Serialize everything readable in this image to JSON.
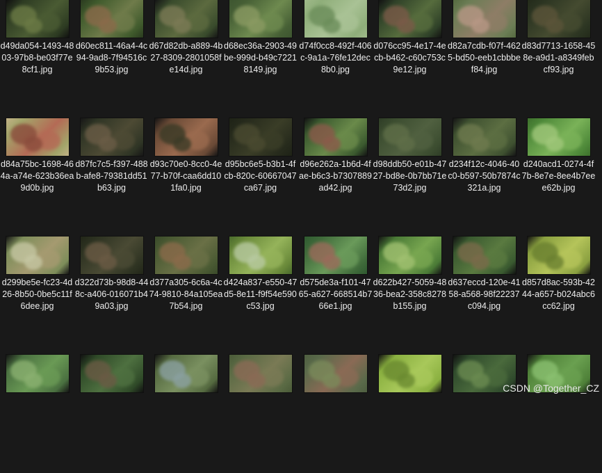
{
  "files": [
    {
      "name": "d49da054-1493-4803-97b8-be03f77e8cf1.jpg",
      "colors": [
        "#2d3b22",
        "#4a5b33",
        "#6b7a45",
        "#101010"
      ]
    },
    {
      "name": "d60ec811-46a4-4c94-9ad8-7f94516c9b53.jpg",
      "colors": [
        "#3f5a2c",
        "#6f7b4a",
        "#8a6a4a",
        "#2a3a1f"
      ]
    },
    {
      "name": "d67d82db-a889-4b27-8309-2801058fe14d.jpg",
      "colors": [
        "#394b2c",
        "#5c6a3f",
        "#7b7a55",
        "#151515"
      ]
    },
    {
      "name": "d68ec36a-2903-49be-999d-b49c72218149.jpg",
      "colors": [
        "#465f35",
        "#6e8a4f",
        "#8a9a62",
        "#3d5530"
      ]
    },
    {
      "name": "d74f0cc8-492f-406c-9a1a-76fe12dec8b0.jpg",
      "colors": [
        "#8fae7a",
        "#a9c295",
        "#6b8d5a",
        "#9fb98a"
      ]
    },
    {
      "name": "d076cc95-4e17-4ecb-b462-c60c753c9e12.jpg",
      "colors": [
        "#2f4128",
        "#566c3d",
        "#7a5a48",
        "#121212"
      ]
    },
    {
      "name": "d82a7cdb-f07f-4625-bd50-eeb1cbbbef84.jpg",
      "colors": [
        "#6c7d55",
        "#8e7d66",
        "#b79785",
        "#556a40"
      ]
    },
    {
      "name": "d83d7713-1658-458e-a9d1-a8349febcf93.jpg",
      "colors": [
        "#2c3522",
        "#454b30",
        "#5b5439",
        "#232a1a"
      ]
    },
    {
      "name": "d84a75bc-1698-464a-a74e-623b36ea9d0b.jpg",
      "colors": [
        "#a3a56a",
        "#b46a55",
        "#8a4c3c",
        "#c2b286"
      ]
    },
    {
      "name": "d87fc7c5-f397-488b-afe8-79381dd51b63.jpg",
      "colors": [
        "#2f3525",
        "#4d4a34",
        "#6a5c46",
        "#161616"
      ]
    },
    {
      "name": "d93c70e0-8cc0-4e77-b70f-caa6dd101fa0.jpg",
      "colors": [
        "#6a4a36",
        "#9a6a4e",
        "#3a3a26",
        "#141414"
      ]
    },
    {
      "name": "d95bc6e5-b3b1-4fcb-820c-60667047ca67.jpg",
      "colors": [
        "#262a1c",
        "#3a3d27",
        "#4a4a30",
        "#1e2216"
      ]
    },
    {
      "name": "d96e262a-1b6d-4fae-b6c3-b7307889ad42.jpg",
      "colors": [
        "#3b5a2f",
        "#6a8a4a",
        "#8a5a4a",
        "#131313"
      ]
    },
    {
      "name": "d98ddb50-e01b-4727-bd8e-0b7bb71e73d2.jpg",
      "colors": [
        "#3c4d30",
        "#506040",
        "#5f6e48",
        "#2e3c26"
      ]
    },
    {
      "name": "d234f12c-4046-40c0-b597-50b7874c321a.jpg",
      "colors": [
        "#3e5030",
        "#5c6e42",
        "#6e7a4e",
        "#151515"
      ]
    },
    {
      "name": "d240acd1-0274-4f7b-8e7e-8ee4b7eee62b.jpg",
      "colors": [
        "#4f8a3a",
        "#7ab258",
        "#a0c77a",
        "#3d6f2c"
      ]
    },
    {
      "name": "d299be5e-fc23-4d26-8b50-0be5c11f6dee.jpg",
      "colors": [
        "#7e8e5a",
        "#a59a70",
        "#c5c6a2",
        "#141414"
      ]
    },
    {
      "name": "d322d73b-98d8-448c-a406-016071b49a03.jpg",
      "colors": [
        "#2e3322",
        "#4a4a34",
        "#6a5a44",
        "#222618"
      ]
    },
    {
      "name": "d377a305-6c6a-4c74-9810-84a105ea7b54.jpg",
      "colors": [
        "#4a5a33",
        "#6a7046",
        "#8a6a4a",
        "#3a4a2a"
      ]
    },
    {
      "name": "d424a837-e550-47d5-8e11-f9f54e590c53.jpg",
      "colors": [
        "#6a8a3a",
        "#95b35a",
        "#b7c9a0",
        "#4a6a2c"
      ]
    },
    {
      "name": "d575de3a-f101-4765-a627-668514b766e1.jpg",
      "colors": [
        "#3f6a3a",
        "#6a9a5a",
        "#9a6a5a",
        "#2f5a30"
      ]
    },
    {
      "name": "d622b427-5059-4836-bea2-358c8278b155.jpg",
      "colors": [
        "#4a7a36",
        "#78a650",
        "#a0c070",
        "#141414"
      ]
    },
    {
      "name": "d637eccd-120e-4158-a568-98f22237c094.jpg",
      "colors": [
        "#3a5a30",
        "#5a7a40",
        "#7a6a4a",
        "#111111"
      ]
    },
    {
      "name": "d857d8ac-593b-4244-a657-b024abc6cc62.jpg",
      "colors": [
        "#8aa040",
        "#b5c45a",
        "#6a8030",
        "#101010"
      ]
    },
    {
      "name": "",
      "colors": [
        "#4a7040",
        "#6a9a55",
        "#8ab070",
        "#141414"
      ]
    },
    {
      "name": "",
      "colors": [
        "#2f4a28",
        "#4e7040",
        "#6a5a44",
        "#111111"
      ]
    },
    {
      "name": "",
      "colors": [
        "#556a40",
        "#7a9060",
        "#8aa0a0",
        "#121212"
      ]
    },
    {
      "name": "",
      "colors": [
        "#5a6a44",
        "#7a7a55",
        "#8a6a55",
        "#4a5a38"
      ]
    },
    {
      "name": "",
      "colors": [
        "#5a6a4a",
        "#8a6a55",
        "#7a8a5a",
        "#4e5e40"
      ]
    },
    {
      "name": "",
      "colors": [
        "#8ab040",
        "#a8c85a",
        "#6a8a30",
        "#101010"
      ]
    },
    {
      "name": "",
      "colors": [
        "#2f4a2c",
        "#4a6a3c",
        "#6a8a50",
        "#111111"
      ]
    },
    {
      "name": "",
      "colors": [
        "#4e8038",
        "#6aa050",
        "#8ac070",
        "#121212"
      ]
    }
  ],
  "watermark": "CSDN @Together_CZ"
}
